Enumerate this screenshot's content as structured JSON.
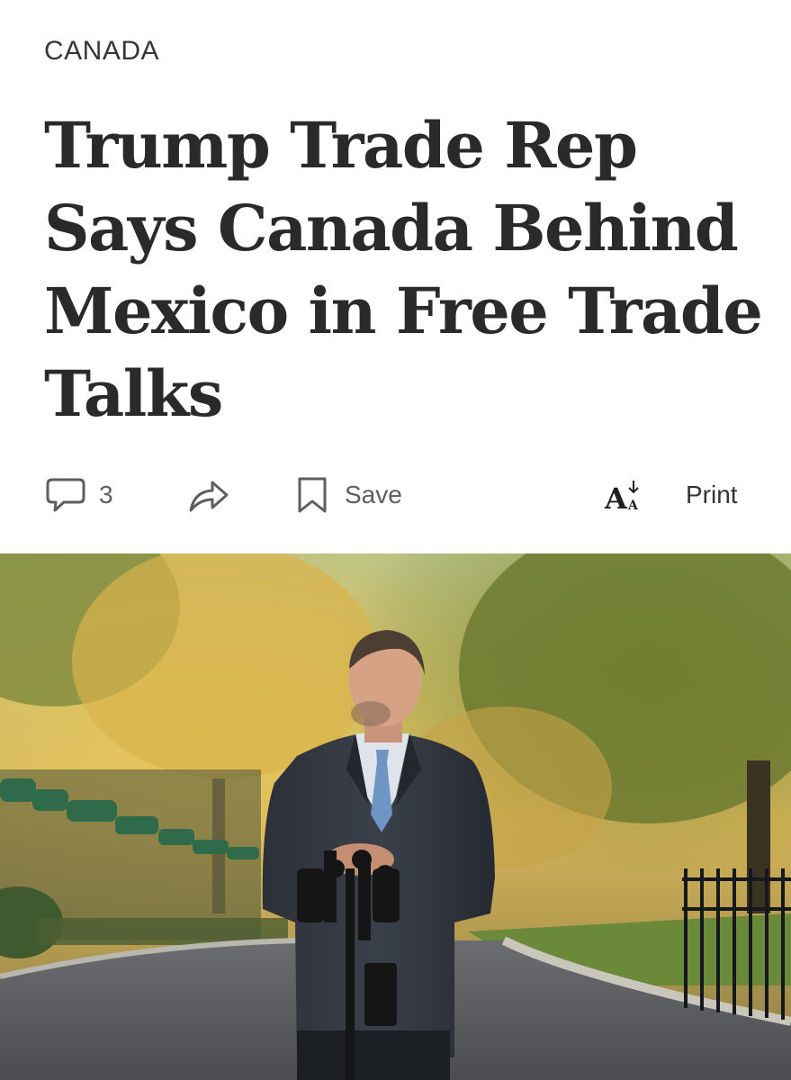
{
  "article": {
    "section": "CANADA",
    "headline": "Trump Trade Rep Says Canada Behind Mexico in Free Trade Talks"
  },
  "toolbar": {
    "comment_count": "3",
    "save_label": "Save",
    "print_label": "Print",
    "icons": {
      "comments": "speech-bubble-icon",
      "share": "share-arrow-icon",
      "save": "bookmark-icon",
      "font_size": "font-size-icon"
    }
  },
  "photo": {
    "subject": "man in dark suit and blue tie standing behind microphones on a tree-lined road in autumn"
  }
}
